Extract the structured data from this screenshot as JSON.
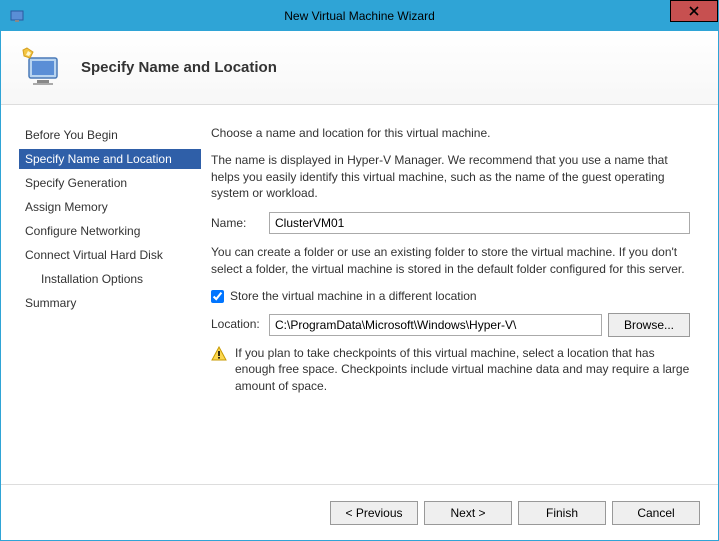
{
  "window": {
    "title": "New Virtual Machine Wizard"
  },
  "header": {
    "title": "Specify Name and Location"
  },
  "sidebar": {
    "items": [
      {
        "label": "Before You Begin"
      },
      {
        "label": "Specify Name and Location"
      },
      {
        "label": "Specify Generation"
      },
      {
        "label": "Assign Memory"
      },
      {
        "label": "Configure Networking"
      },
      {
        "label": "Connect Virtual Hard Disk"
      },
      {
        "label": "Installation Options"
      },
      {
        "label": "Summary"
      }
    ]
  },
  "content": {
    "intro": "Choose a name and location for this virtual machine.",
    "desc": "The name is displayed in Hyper-V Manager. We recommend that you use a name that helps you easily identify this virtual machine, such as the name of the guest operating system or workload.",
    "name_label": "Name:",
    "name_value": "ClusterVM01",
    "folder_desc": "You can create a folder or use an existing folder to store the virtual machine. If you don't select a folder, the virtual machine is stored in the default folder configured for this server.",
    "store_check_label": "Store the virtual machine in a different location",
    "location_label": "Location:",
    "location_value": "C:\\ProgramData\\Microsoft\\Windows\\Hyper-V\\",
    "browse_label": "Browse...",
    "warning": "If you plan to take checkpoints of this virtual machine, select a location that has enough free space. Checkpoints include virtual machine data and may require a large amount of space."
  },
  "footer": {
    "previous": "< Previous",
    "next": "Next >",
    "finish": "Finish",
    "cancel": "Cancel"
  }
}
